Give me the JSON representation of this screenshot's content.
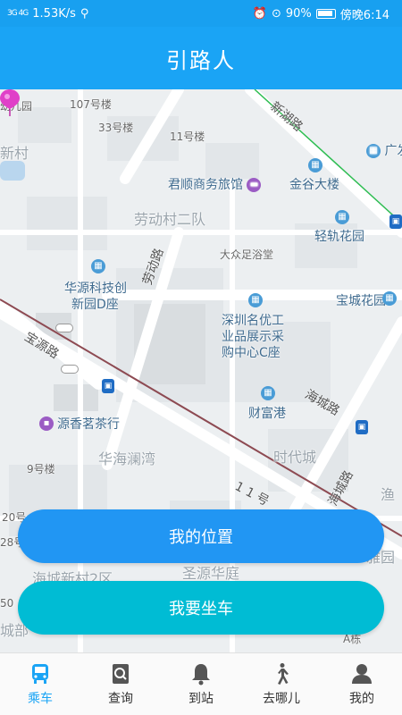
{
  "status": {
    "signal": "3G 4G",
    "speed": "1.53K/s",
    "battery": "90%",
    "time": "傍晚6:14"
  },
  "header": {
    "title": "引路人"
  },
  "map": {
    "pois": {
      "p107": "107号楼",
      "p33": "33号楼",
      "p11": "11号楼",
      "kindergarten": "幼儿园",
      "xincun": "新村",
      "guangfa": "广发大",
      "junshun": "君顺商务旅馆",
      "jingu": "金谷大楼",
      "laodong": "劳动村二队",
      "qinggui": "轻轨花园",
      "dazhong": "大众足浴堂",
      "huayuan1": "华源科技创",
      "huayuan2": "新园D座",
      "baocheng": "宝城花园",
      "shenzhen1": "深圳名优工",
      "shenzhen2": "业品展示采",
      "shenzhen3": "购中心C座",
      "caifugang": "财富港",
      "yuanxiang": "源香茗茶行",
      "huahai": "华海澜湾",
      "shidai": "时代城",
      "p9": "9号楼",
      "p20": "20号",
      "p28": "28号",
      "yu": "渔",
      "yaoyuan": "雅园",
      "haicheng2": "海城新村2区",
      "shengyuan": "圣源华庭",
      "chengbu": "城部",
      "p50": "50",
      "abiao": "A栋"
    },
    "roads": {
      "xinhu": "新湖路",
      "laodong_rd": "劳动路",
      "baoyuan": "宝源路",
      "haicheng": "海城路",
      "haicheng_v": "海城路",
      "shiyi": "1 1 号"
    }
  },
  "actions": {
    "location": "我的位置",
    "ride": "我要坐车"
  },
  "tabs": [
    {
      "label": "乘车",
      "icon": "bus-icon"
    },
    {
      "label": "查询",
      "icon": "search-doc-icon"
    },
    {
      "label": "到站",
      "icon": "bell-icon"
    },
    {
      "label": "去哪儿",
      "icon": "walk-icon"
    },
    {
      "label": "我的",
      "icon": "person-icon"
    }
  ],
  "colors": {
    "primary": "#1aa4f5",
    "button_blue": "#2196f3",
    "button_cyan": "#00bcd4",
    "pin": "#e040c8"
  }
}
